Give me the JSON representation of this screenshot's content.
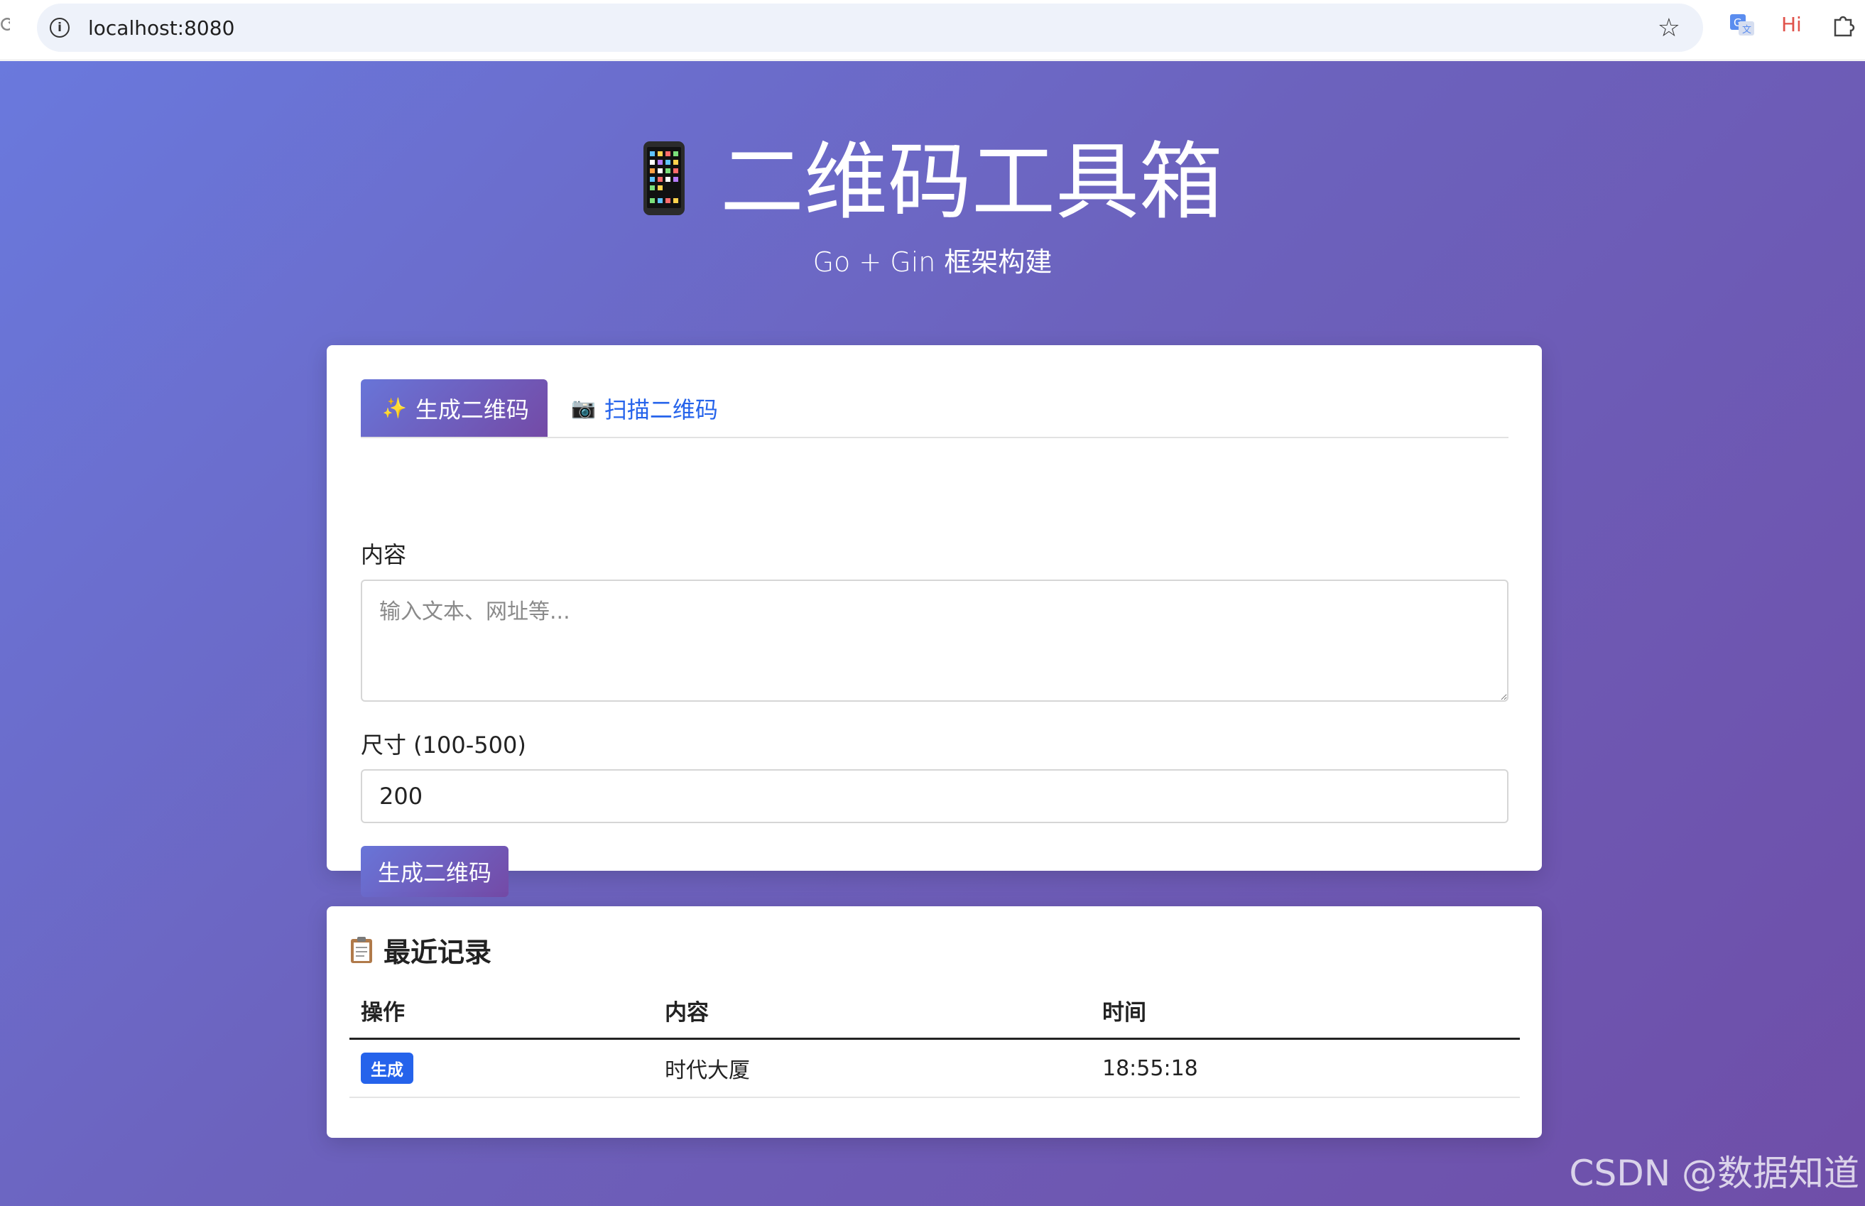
{
  "browser": {
    "url": "localhost:8080",
    "hi_label": "Hi"
  },
  "hero": {
    "title": "二维码工具箱",
    "subtitle": "Go + Gin 框架构建"
  },
  "tabs": [
    {
      "icon": "✨",
      "label": "生成二维码",
      "active": true
    },
    {
      "icon": "📷",
      "label": "扫描二维码",
      "active": false
    }
  ],
  "form": {
    "content_label": "内容",
    "content_placeholder": "输入文本、网址等...",
    "size_label": "尺寸 (100-500)",
    "size_value": "200",
    "submit_label": "生成二维码"
  },
  "history": {
    "title": "最近记录",
    "columns": [
      "操作",
      "内容",
      "时间"
    ],
    "rows": [
      {
        "action": "生成",
        "content": "时代大厦",
        "time": "18:55:18"
      }
    ]
  },
  "watermark": "CSDN @数据知道",
  "colors": {
    "accent_start": "#6875d8",
    "accent_end": "#744aa6",
    "link_blue": "#2563eb"
  }
}
